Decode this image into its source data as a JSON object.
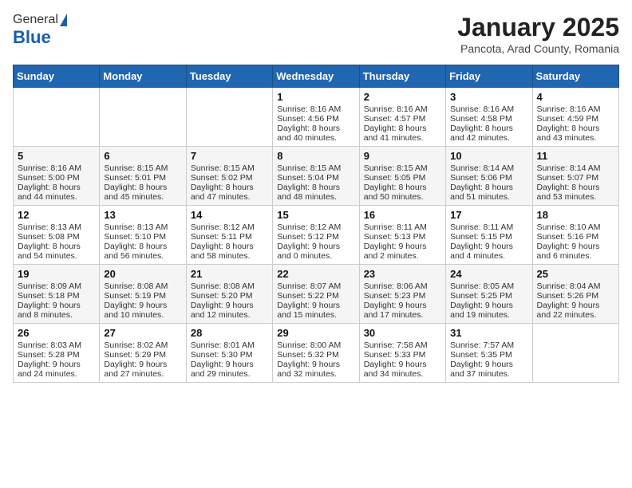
{
  "logo": {
    "general": "General",
    "blue": "Blue"
  },
  "title": "January 2025",
  "location": "Pancota, Arad County, Romania",
  "days_header": [
    "Sunday",
    "Monday",
    "Tuesday",
    "Wednesday",
    "Thursday",
    "Friday",
    "Saturday"
  ],
  "weeks": [
    [
      {
        "day": "",
        "info": ""
      },
      {
        "day": "",
        "info": ""
      },
      {
        "day": "",
        "info": ""
      },
      {
        "day": "1",
        "info": "Sunrise: 8:16 AM\nSunset: 4:56 PM\nDaylight: 8 hours\nand 40 minutes."
      },
      {
        "day": "2",
        "info": "Sunrise: 8:16 AM\nSunset: 4:57 PM\nDaylight: 8 hours\nand 41 minutes."
      },
      {
        "day": "3",
        "info": "Sunrise: 8:16 AM\nSunset: 4:58 PM\nDaylight: 8 hours\nand 42 minutes."
      },
      {
        "day": "4",
        "info": "Sunrise: 8:16 AM\nSunset: 4:59 PM\nDaylight: 8 hours\nand 43 minutes."
      }
    ],
    [
      {
        "day": "5",
        "info": "Sunrise: 8:16 AM\nSunset: 5:00 PM\nDaylight: 8 hours\nand 44 minutes."
      },
      {
        "day": "6",
        "info": "Sunrise: 8:15 AM\nSunset: 5:01 PM\nDaylight: 8 hours\nand 45 minutes."
      },
      {
        "day": "7",
        "info": "Sunrise: 8:15 AM\nSunset: 5:02 PM\nDaylight: 8 hours\nand 47 minutes."
      },
      {
        "day": "8",
        "info": "Sunrise: 8:15 AM\nSunset: 5:04 PM\nDaylight: 8 hours\nand 48 minutes."
      },
      {
        "day": "9",
        "info": "Sunrise: 8:15 AM\nSunset: 5:05 PM\nDaylight: 8 hours\nand 50 minutes."
      },
      {
        "day": "10",
        "info": "Sunrise: 8:14 AM\nSunset: 5:06 PM\nDaylight: 8 hours\nand 51 minutes."
      },
      {
        "day": "11",
        "info": "Sunrise: 8:14 AM\nSunset: 5:07 PM\nDaylight: 8 hours\nand 53 minutes."
      }
    ],
    [
      {
        "day": "12",
        "info": "Sunrise: 8:13 AM\nSunset: 5:08 PM\nDaylight: 8 hours\nand 54 minutes."
      },
      {
        "day": "13",
        "info": "Sunrise: 8:13 AM\nSunset: 5:10 PM\nDaylight: 8 hours\nand 56 minutes."
      },
      {
        "day": "14",
        "info": "Sunrise: 8:12 AM\nSunset: 5:11 PM\nDaylight: 8 hours\nand 58 minutes."
      },
      {
        "day": "15",
        "info": "Sunrise: 8:12 AM\nSunset: 5:12 PM\nDaylight: 9 hours\nand 0 minutes."
      },
      {
        "day": "16",
        "info": "Sunrise: 8:11 AM\nSunset: 5:13 PM\nDaylight: 9 hours\nand 2 minutes."
      },
      {
        "day": "17",
        "info": "Sunrise: 8:11 AM\nSunset: 5:15 PM\nDaylight: 9 hours\nand 4 minutes."
      },
      {
        "day": "18",
        "info": "Sunrise: 8:10 AM\nSunset: 5:16 PM\nDaylight: 9 hours\nand 6 minutes."
      }
    ],
    [
      {
        "day": "19",
        "info": "Sunrise: 8:09 AM\nSunset: 5:18 PM\nDaylight: 9 hours\nand 8 minutes."
      },
      {
        "day": "20",
        "info": "Sunrise: 8:08 AM\nSunset: 5:19 PM\nDaylight: 9 hours\nand 10 minutes."
      },
      {
        "day": "21",
        "info": "Sunrise: 8:08 AM\nSunset: 5:20 PM\nDaylight: 9 hours\nand 12 minutes."
      },
      {
        "day": "22",
        "info": "Sunrise: 8:07 AM\nSunset: 5:22 PM\nDaylight: 9 hours\nand 15 minutes."
      },
      {
        "day": "23",
        "info": "Sunrise: 8:06 AM\nSunset: 5:23 PM\nDaylight: 9 hours\nand 17 minutes."
      },
      {
        "day": "24",
        "info": "Sunrise: 8:05 AM\nSunset: 5:25 PM\nDaylight: 9 hours\nand 19 minutes."
      },
      {
        "day": "25",
        "info": "Sunrise: 8:04 AM\nSunset: 5:26 PM\nDaylight: 9 hours\nand 22 minutes."
      }
    ],
    [
      {
        "day": "26",
        "info": "Sunrise: 8:03 AM\nSunset: 5:28 PM\nDaylight: 9 hours\nand 24 minutes."
      },
      {
        "day": "27",
        "info": "Sunrise: 8:02 AM\nSunset: 5:29 PM\nDaylight: 9 hours\nand 27 minutes."
      },
      {
        "day": "28",
        "info": "Sunrise: 8:01 AM\nSunset: 5:30 PM\nDaylight: 9 hours\nand 29 minutes."
      },
      {
        "day": "29",
        "info": "Sunrise: 8:00 AM\nSunset: 5:32 PM\nDaylight: 9 hours\nand 32 minutes."
      },
      {
        "day": "30",
        "info": "Sunrise: 7:58 AM\nSunset: 5:33 PM\nDaylight: 9 hours\nand 34 minutes."
      },
      {
        "day": "31",
        "info": "Sunrise: 7:57 AM\nSunset: 5:35 PM\nDaylight: 9 hours\nand 37 minutes."
      },
      {
        "day": "",
        "info": ""
      }
    ]
  ]
}
